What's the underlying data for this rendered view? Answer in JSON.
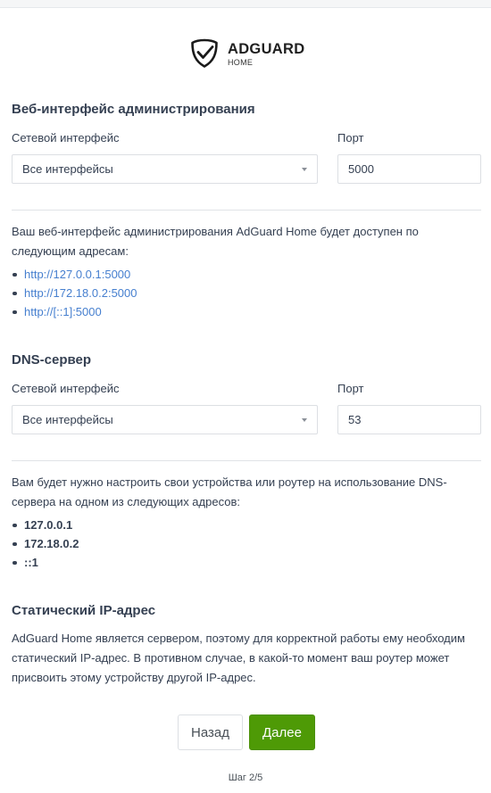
{
  "logo": {
    "name": "ADGUARD",
    "sub": "HOME",
    "icon": "shield-check-icon"
  },
  "web": {
    "title": "Веб-интерфейс администрирования",
    "interface_label": "Сетевой интерфейс",
    "interface_value": "Все интерфейсы",
    "port_label": "Порт",
    "port_value": "5000",
    "info": "Ваш веб-интерфейс администрирования AdGuard Home будет доступен по следующим адресам:",
    "addresses": [
      "http://127.0.0.1:5000",
      "http://172.18.0.2:5000",
      "http://[::1]:5000"
    ]
  },
  "dns": {
    "title": "DNS-сервер",
    "interface_label": "Сетевой интерфейс",
    "interface_value": "Все интерфейсы",
    "port_label": "Порт",
    "port_value": "53",
    "info": "Вам будет нужно настроить свои устройства или роутер на использование DNS-сервера на одном из следующих адресов:",
    "addresses": [
      "127.0.0.1",
      "172.18.0.2",
      "::1"
    ]
  },
  "static_ip": {
    "title": "Статический IP-адрес",
    "text": "AdGuard Home является сервером, поэтому для корректной работы ему необходим статический IP-адрес. В противном случае, в какой-то момент ваш роутер может присвоить этому устройству другой IP-адрес."
  },
  "buttons": {
    "back": "Назад",
    "next": "Далее"
  },
  "step": "Шаг 2/5",
  "colors": {
    "accent": "#4e9a06",
    "link": "#467fcf"
  }
}
